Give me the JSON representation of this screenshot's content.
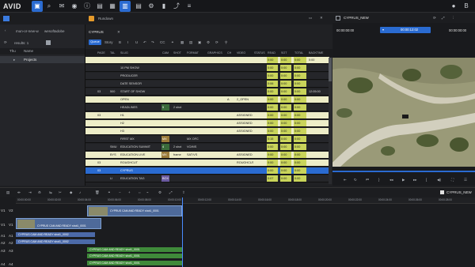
{
  "app": {
    "logo": "AVID",
    "toolbar_icons": [
      "folder-icon",
      "search-icon",
      "mail-icon",
      "eye-icon",
      "info-icon",
      "layout-icon",
      "film-icon",
      "list-icon",
      "rundown-icon",
      "gear-icon",
      "chart-icon",
      "share-icon",
      "menu-icon",
      "mic-icon"
    ],
    "user_initial": "B"
  },
  "left_panel": {
    "tab_label": "",
    "path": [
      "mun-or-new-w",
      "wesoftadobe"
    ],
    "results": "results: 1",
    "column_headers": [
      "Thu",
      "Name"
    ],
    "items": [
      "Projects"
    ]
  },
  "rundown": {
    "tab_label": "Rundown",
    "title": "CYPRUS",
    "sub_tabs": [
      "Queue",
      "Story"
    ],
    "columns": [
      "PAGE",
      "TAL",
      "SLUG",
      "CAM",
      "SHOT",
      "FORMAT",
      "GRAPHICS",
      "CH",
      "VIDEO",
      "STATUS",
      "READ",
      "SOT",
      "TOTAL",
      "BACKTIME",
      "O"
    ],
    "rows": [
      {
        "page": "",
        "tal": "",
        "slug": "",
        "cam": "",
        "shot": "",
        "format": "",
        "graphics": "",
        "ch": "",
        "video": "",
        "status": "",
        "read": "0:00",
        "sot": "0:00",
        "total": "0:00",
        "backtime": "0:00",
        "style": "yellow"
      },
      {
        "page": "",
        "tal": "",
        "slug": "10 PM SHOW",
        "cam": "",
        "shot": "",
        "format": "",
        "graphics": "",
        "ch": "",
        "video": "",
        "status": "",
        "read": "0:00",
        "sot": "0:00",
        "total": "0:00",
        "backtime": "",
        "style": "dark"
      },
      {
        "page": "",
        "tal": "",
        "slug": "PRODUCER",
        "cam": "",
        "shot": "",
        "format": "",
        "graphics": "",
        "ch": "",
        "video": "",
        "status": "",
        "read": "0:00",
        "sot": "0:00",
        "total": "0:00",
        "backtime": "",
        "style": "dark"
      },
      {
        "page": "",
        "tal": "",
        "slug": "DATE SENSOR",
        "cam": "",
        "shot": "",
        "format": "",
        "graphics": "",
        "ch": "",
        "video": "",
        "status": "",
        "read": "0:06",
        "sot": "0:00",
        "total": "0:00",
        "backtime": "",
        "style": "dark"
      },
      {
        "page": "03",
        "tal": "500",
        "slug": "START OF SHOW",
        "cam": "",
        "shot": "",
        "format": "",
        "graphics": "",
        "ch": "",
        "video": "",
        "status": "",
        "read": "0:00",
        "sot": "0:00",
        "total": "0:00",
        "backtime": "12:05:00",
        "style": "dark"
      },
      {
        "page": "",
        "tal": "",
        "slug": "OPEN",
        "cam": "",
        "shot": "",
        "format": "",
        "graphics": "",
        "ch": "A",
        "video": "2_OPEN",
        "status": "",
        "read": "0:00",
        "sot": "0:00",
        "total": "0:00",
        "backtime": "",
        "style": "yellow"
      },
      {
        "page": "",
        "tal": "",
        "slug": "HEADLINES",
        "cam": "5",
        "shot": "2 shot",
        "format": "",
        "graphics": "",
        "ch": "",
        "video": "",
        "status": "",
        "read": "0:00",
        "sot": "0:00",
        "total": "0:00",
        "backtime": "",
        "style": "dark"
      },
      {
        "page": "03",
        "tal": "",
        "slug": "H1",
        "cam": "",
        "shot": "",
        "format": "",
        "graphics": "",
        "ch": "",
        "video": "ASSIGNED",
        "status": "",
        "read": "0:00",
        "sot": "0:00",
        "total": "0:00",
        "backtime": "",
        "style": "yellow"
      },
      {
        "page": "",
        "tal": "",
        "slug": "H2",
        "cam": "",
        "shot": "",
        "format": "",
        "graphics": "",
        "ch": "",
        "video": "ASSIGNED",
        "status": "",
        "read": "0:00",
        "sot": "0:00",
        "total": "0:00",
        "backtime": "",
        "style": "yellow"
      },
      {
        "page": "",
        "tal": "",
        "slug": "H3",
        "cam": "",
        "shot": "",
        "format": "",
        "graphics": "",
        "ch": "",
        "video": "ASSIGNED",
        "status": "",
        "read": "0:00",
        "sot": "0:00",
        "total": "0:00",
        "backtime": "",
        "style": "yellow"
      },
      {
        "page": "",
        "tal": "",
        "slug": "FIRST MX",
        "cam": "MX",
        "shot": "",
        "format": "MX OFC",
        "graphics": "",
        "ch": "",
        "video": "",
        "status": "",
        "read": "0:15",
        "sot": "0:00",
        "total": "0:00",
        "backtime": "",
        "style": "dark"
      },
      {
        "page": "",
        "tal": "SMU",
        "slug": "EDUCATION SUMMIT",
        "cam": "4",
        "shot": "2 shot",
        "format": "VO/MS",
        "graphics": "",
        "ch": "",
        "video": "",
        "status": "",
        "read": "0:00",
        "sot": "0:00",
        "total": "0:00",
        "backtime": "",
        "style": "dark"
      },
      {
        "page": "",
        "tal": "BYS",
        "slug": "EDUCATION LIVE",
        "cam": "MX",
        "shot": "frame",
        "format": "SAT/VS",
        "graphics": "",
        "ch": "",
        "video": "ASSIGNED",
        "status": "",
        "read": "0:00",
        "sot": "0:00",
        "total": "0:00",
        "backtime": "",
        "style": "yellow"
      },
      {
        "page": "03",
        "tal": "",
        "slug": "ROUGHCUT",
        "cam": "",
        "shot": "",
        "format": "",
        "graphics": "",
        "ch": "",
        "video": "ROUGHCUT",
        "status": "",
        "read": "0:00",
        "sot": "0:00",
        "total": "0:00",
        "backtime": "",
        "style": "yellow"
      },
      {
        "page": "03",
        "tal": "",
        "slug": "CYPRUS",
        "cam": "",
        "shot": "",
        "format": "",
        "graphics": "",
        "ch": "",
        "video": "",
        "status": "",
        "read": "0:00",
        "sot": "0:00",
        "total": "0:00",
        "backtime": "",
        "style": "selected"
      },
      {
        "page": "",
        "tal": "LI",
        "slug": "EDUCATION TAG",
        "cam": "BOX",
        "shot": "",
        "format": "",
        "graphics": "",
        "ch": "",
        "video": "",
        "status": "",
        "read": "0:07",
        "sot": "0:00",
        "total": "0:00",
        "backtime": "",
        "style": "dark"
      }
    ]
  },
  "viewer": {
    "sequence_name": "CYPRUS_NEW",
    "timecode_left": "00:00:00:00",
    "timecode_mid": "00:00:12:02",
    "timecode_right": "00:00:00:00",
    "colors": {
      "accent": "#2a6bd1"
    }
  },
  "timeline": {
    "sequence_name": "CYPRUS_NEW",
    "ruler_ticks": [
      "00:00:00:00",
      "00:00:02:00",
      "00:00:04:00",
      "00:00:06:00",
      "00:00:08:00",
      "00:00:10:00",
      "00:00:12:00",
      "00:00:14:00",
      "00:00:16:00",
      "00:00:18:00",
      "00:00:20:00",
      "00:00:22:00",
      "00:00:24:00",
      "00:00:26:00",
      "00:00:28:00"
    ],
    "tracks": [
      {
        "label": "V1",
        "src": "V2"
      },
      {
        "label": "V1",
        "src": "V1"
      },
      {
        "label": "A1",
        "src": "A1"
      },
      {
        "label": "A2",
        "src": "A2"
      },
      {
        "label": "A3",
        "src": "A3"
      },
      {
        "label": "A4",
        "src": "A4"
      }
    ],
    "clips": [
      {
        "label": "CYPRUS CAM AND READY shot1_0001"
      },
      {
        "label": "CYPRUS CAM AND READY shot1_0001"
      },
      {
        "label": "CYPRUS CAM AND READY shot1_0002"
      },
      {
        "label": "CYPRUS CAM AND READY shot1_0002"
      },
      {
        "label": "CYPRUS CAM AND READY shot1_0001"
      },
      {
        "label": "CYPRUS CAM AND READY shot1_0001"
      },
      {
        "label": "CYPRUS CAM AND READY shot1_0001"
      },
      {
        "label": "CYPRUS CAM AND READY shot1_0001"
      }
    ]
  }
}
